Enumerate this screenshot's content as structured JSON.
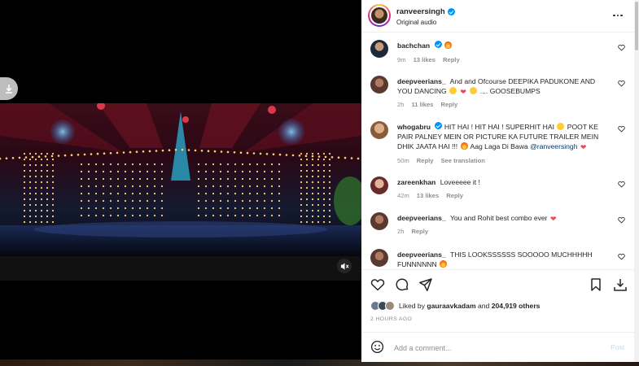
{
  "post": {
    "username": "ranveersingh",
    "subtitle": "Original audio"
  },
  "comments": [
    {
      "user": "bachchan",
      "text": "",
      "emoji": [
        "fire"
      ],
      "age": "9m",
      "likes": "13 likes",
      "reply": "Reply"
    },
    {
      "user": "deepveerians_",
      "text": "And and Ofcourse DEEPIKA PADUKONE AND YOU DANCING",
      "tail": ".... GOOSEBUMPS",
      "age": "2h",
      "likes": "11 likes",
      "reply": "Reply"
    },
    {
      "user": "whogabru",
      "text": "HIT HAI ! HIT HAI ! SUPERHIT HAI",
      "text2": "POOT KE PAIR PALNEY MEIN OR PICTURE KA FUTURE TRAILER MEIN DHIK JAATA HAI !!!",
      "text3": "Aag Laga Di Bawa",
      "mention": "@ranveersingh",
      "age": "50m",
      "reply": "Reply",
      "see_translation": "See translation"
    },
    {
      "user": "zareenkhan",
      "text": "Loveeeee it !",
      "age": "42m",
      "likes": "13 likes",
      "reply": "Reply"
    },
    {
      "user": "deepveerians_",
      "text": "You and Rohit best combo ever",
      "age": "2h",
      "reply": "Reply"
    },
    {
      "user": "deepveerians_",
      "text": "THIS LOOKSSSSSS SOOOOO MUCHHHHH FUNNNNNN"
    }
  ],
  "likes": {
    "prefix": "Liked by",
    "user": "gauraavkadam",
    "and": "and",
    "count": "204,919 others"
  },
  "timestamp": "2 HOURS AGO",
  "add_comment": {
    "placeholder": "Add a comment...",
    "post_label": "Post"
  },
  "colors": {
    "verified": "#0095f6",
    "heart": "#ed4956",
    "post_disabled": "#b2dffc",
    "muted_text": "#8e8e8e"
  },
  "icons": [
    "download-icon",
    "mute-icon",
    "more-icon",
    "heart-icon",
    "comment-icon",
    "share-icon",
    "bookmark-icon",
    "save-download-icon",
    "emoji-icon"
  ]
}
